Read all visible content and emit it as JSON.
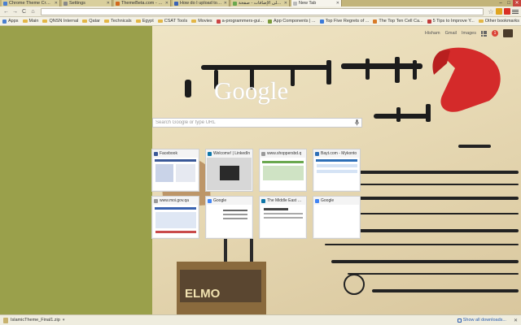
{
  "tabs": [
    {
      "label": "Chrome Theme Creator",
      "color": "#4a7fd1"
    },
    {
      "label": "Settings",
      "color": "#8a8a8a"
    },
    {
      "label": "ThemeBeta.com - Edit tha",
      "color": "#d2691e"
    },
    {
      "label": "How do I upload to the C",
      "color": "#3a62b6"
    },
    {
      "label": "تطبيقات على الإضافات - صفحة",
      "color": "#6aa84f"
    },
    {
      "label": "New Tab",
      "color": "#bbbbbb"
    }
  ],
  "active_tab_index": 5,
  "window_controls": {
    "minimize": "–",
    "maximize": "□",
    "close": "✕"
  },
  "toolbar": {
    "back": "←",
    "forward": "→",
    "reload": "C",
    "home": "⌂",
    "star": "☆",
    "url": ""
  },
  "bookmarks": {
    "items": [
      {
        "label": "Apps",
        "type": "apps"
      },
      {
        "label": "Main",
        "type": "folder"
      },
      {
        "label": "QNSN Internal",
        "type": "folder"
      },
      {
        "label": "Qatar",
        "type": "folder"
      },
      {
        "label": "Technicals",
        "type": "folder"
      },
      {
        "label": "Egypt",
        "type": "folder"
      },
      {
        "label": "CSAT Tools",
        "type": "folder"
      },
      {
        "label": "Movies",
        "type": "folder"
      },
      {
        "label": "a-programmers-gui...",
        "type": "link",
        "color": "#cc4444"
      },
      {
        "label": "App Components | ...",
        "type": "link",
        "color": "#7a9a3a"
      },
      {
        "label": "Top Five Regrets of ...",
        "type": "link",
        "color": "#3b7ad9"
      },
      {
        "label": "The Top Ten Cell Ca...",
        "type": "link",
        "color": "#d87a27"
      },
      {
        "label": "5 Tips to Improve Y...",
        "type": "link",
        "color": "#c23b3b"
      }
    ],
    "other_bookmarks": "Other bookmarks"
  },
  "google": {
    "links": [
      "Hisham",
      "Gmail",
      "Images"
    ],
    "notification_count": "1",
    "logo_text": "Google",
    "search_placeholder": "Search Google or type URL"
  },
  "tiles": [
    {
      "title": "Facebook",
      "icon_color": "#3b5998",
      "accent": "#3b5998"
    },
    {
      "title": "Welcome! | LinkedIn",
      "icon_color": "#0e76a8",
      "accent": "#2a2a2a"
    },
    {
      "title": "www.shoppersbd.q",
      "icon_color": "#9a9a9a",
      "accent": "#6aa84f"
    },
    {
      "title": "Bayt.com - Mykonto",
      "icon_color": "#2e6fb7",
      "accent": "#2e6fb7"
    },
    {
      "title": "www.moi.gov.qa",
      "icon_color": "#9a9a9a",
      "accent": "#3a63b0"
    },
    {
      "title": "Google",
      "icon_color": "#4285f4",
      "accent": "#666666"
    },
    {
      "title": "The Middle East Un...",
      "icon_color": "#0e76a8",
      "accent": "#444444"
    },
    {
      "title": "Google",
      "icon_color": "#4285f4",
      "accent": "#ffffff"
    }
  ],
  "download_shelf": {
    "file_name": "IslamicTheme_Final1.zip",
    "show_all": "Show all downloads...",
    "close": "✕"
  }
}
